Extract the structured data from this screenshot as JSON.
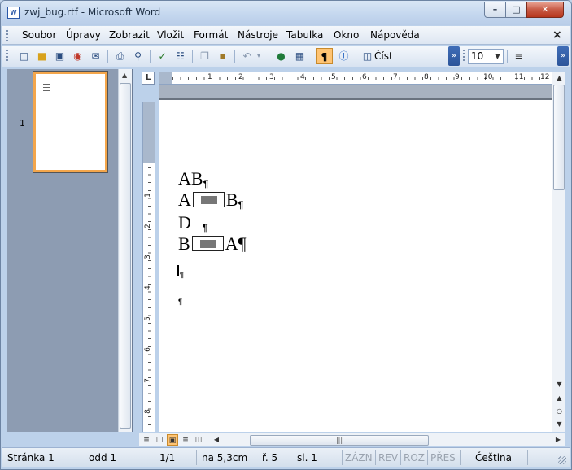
{
  "window": {
    "title": "zwj_bug.rtf - Microsoft Word",
    "icon_label": "W",
    "min_glyph": "–",
    "max_glyph": "□",
    "close_glyph": "✕"
  },
  "menu": {
    "items": [
      "Soubor",
      "Úpravy",
      "Zobrazit",
      "Vložit",
      "Formát",
      "Nástroje",
      "Tabulka",
      "Okno",
      "Nápověda"
    ],
    "close_glyph": "×"
  },
  "toolbar": {
    "read_label": "Číst",
    "font_size": "10",
    "pilcrow": "¶",
    "icons": [
      "new-document-icon",
      "open-folder-icon",
      "save-icon",
      "permission-icon",
      "email-icon",
      "print-icon",
      "print-preview-icon",
      "spelling-icon",
      "research-icon",
      "copy-icon",
      "paste-icon",
      "undo-icon",
      "hyperlink-icon",
      "table-icon",
      "show-formatting-icon",
      "help-icon",
      "read-icon",
      "align-icon"
    ]
  },
  "thumbnails": {
    "page_number": "1"
  },
  "ruler": {
    "corner": "L",
    "h_numbers": [
      "1",
      "2",
      "3",
      "4",
      "5",
      "6",
      "7",
      "8",
      "9",
      "10",
      "11",
      "12"
    ],
    "v_numbers": [
      "1",
      "2",
      "3",
      "4",
      "5",
      "6",
      "7",
      "8"
    ]
  },
  "document": {
    "lines": [
      {
        "before": "AB",
        "field": false,
        "after": "",
        "mark": "¶"
      },
      {
        "before": "A",
        "field": true,
        "after": "B",
        "mark": "¶"
      },
      {
        "before": "D",
        "field": false,
        "after": "",
        "mark": "¶"
      },
      {
        "before": "B",
        "field": true,
        "after": "A",
        "mark": "¶"
      }
    ],
    "line1_text": "AB",
    "line2_a": "A",
    "line2_b": "B",
    "line3_text": "D",
    "line4_a": "B",
    "line4_b": "A",
    "pilcrow": "¶"
  },
  "statusbar": {
    "page": "Stránka 1",
    "section": "odd 1",
    "pages": "1/1",
    "position": "na 5,3cm",
    "line": "ř. 5",
    "column": "sl. 1",
    "rec": "ZÁZN",
    "trk": "REV",
    "ext": "ROZ",
    "ovr": "PŘES",
    "language": "Čeština"
  }
}
